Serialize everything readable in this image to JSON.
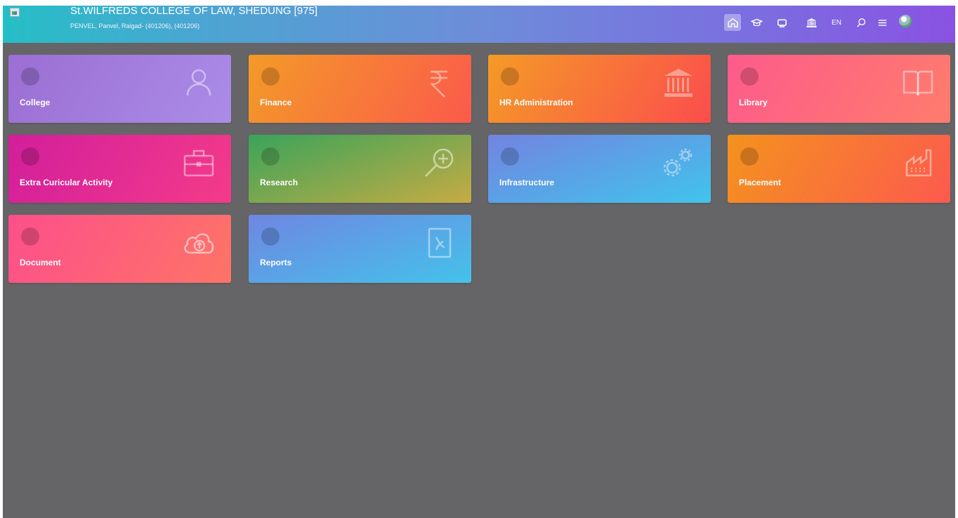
{
  "header": {
    "org_name": "St.WILFREDS COLLEGE OF LAW, SHEDUNG [975]",
    "org_address": "PENVEL, Panvel, Raigad- (401206), (401206)",
    "language": "EN",
    "icons": [
      "home-icon",
      "graduation-cap-icon",
      "monitor-icon",
      "institution-icon",
      "search-icon",
      "menu-icon",
      "avatar"
    ]
  },
  "modules": [
    {
      "label": "College",
      "icon": "user-icon",
      "colors": [
        "#9b6ed3",
        "#ab8ce8"
      ]
    },
    {
      "label": "Finance",
      "icon": "rupee-icon",
      "colors": [
        "#f39a28",
        "#fb5a4b"
      ]
    },
    {
      "label": "HR Administration",
      "icon": "institution-icon",
      "colors": [
        "#f49a26",
        "#fb4d4d"
      ]
    },
    {
      "label": "Library",
      "icon": "book-icon",
      "colors": [
        "#fd5b8b",
        "#fe7c6c"
      ]
    },
    {
      "label": "Extra Curicular Activity",
      "icon": "briefcase-icon",
      "colors": [
        "#d21e9c",
        "#f43b89"
      ]
    },
    {
      "label": "Research",
      "icon": "zoom-in-icon",
      "colors": [
        "#3aa45a",
        "#c6ab43"
      ]
    },
    {
      "label": "Infrastructure",
      "icon": "gears-icon",
      "colors": [
        "#7383e0",
        "#40c4ec"
      ]
    },
    {
      "label": "Placement",
      "icon": "factory-icon",
      "colors": [
        "#f4921e",
        "#fc5a4e"
      ]
    },
    {
      "label": "Document",
      "icon": "cloud-upload-icon",
      "colors": [
        "#fd4f8b",
        "#fd7466"
      ]
    },
    {
      "label": "Reports",
      "icon": "pdf-file-icon",
      "colors": [
        "#6f86e2",
        "#44c2ea"
      ]
    }
  ]
}
